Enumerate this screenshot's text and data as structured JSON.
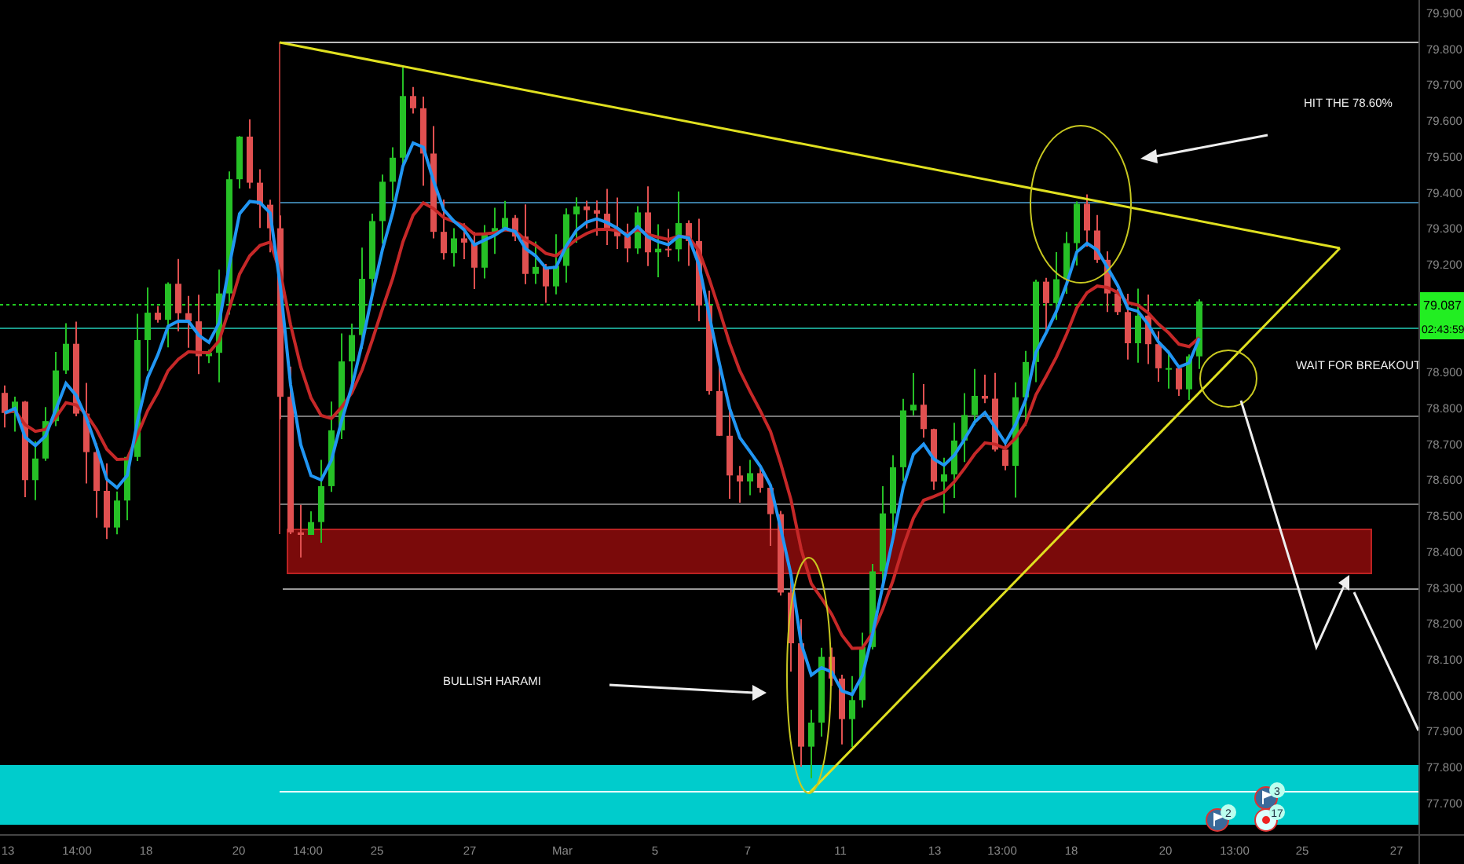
{
  "price_axis": {
    "labels": [
      "79.900",
      "79.800",
      "79.700",
      "79.600",
      "79.500",
      "79.400",
      "79.300",
      "79.200",
      "78.900",
      "78.800",
      "78.700",
      "78.600",
      "78.500",
      "78.400",
      "78.300",
      "78.200",
      "78.100",
      "78.000",
      "77.900",
      "77.800",
      "77.700"
    ]
  },
  "price_tags": {
    "last_price": "79.087",
    "countdown": "02:43:59"
  },
  "time_axis": {
    "labels": [
      "13",
      "14:00",
      "18",
      "20",
      "14:00",
      "25",
      "27",
      "Mar",
      "5",
      "7",
      "11",
      "13",
      "13:00",
      "18",
      "20",
      "13:00",
      "25",
      "27"
    ]
  },
  "annotations": [
    "HIT THE 78.60%",
    "WAIT FOR BREAKOUT",
    "BULLISH HARAMI"
  ],
  "event_markers": [
    {
      "kind": "flag",
      "count": "2"
    },
    {
      "kind": "flag",
      "count": "3"
    },
    {
      "kind": "dot",
      "count": "17"
    }
  ]
}
